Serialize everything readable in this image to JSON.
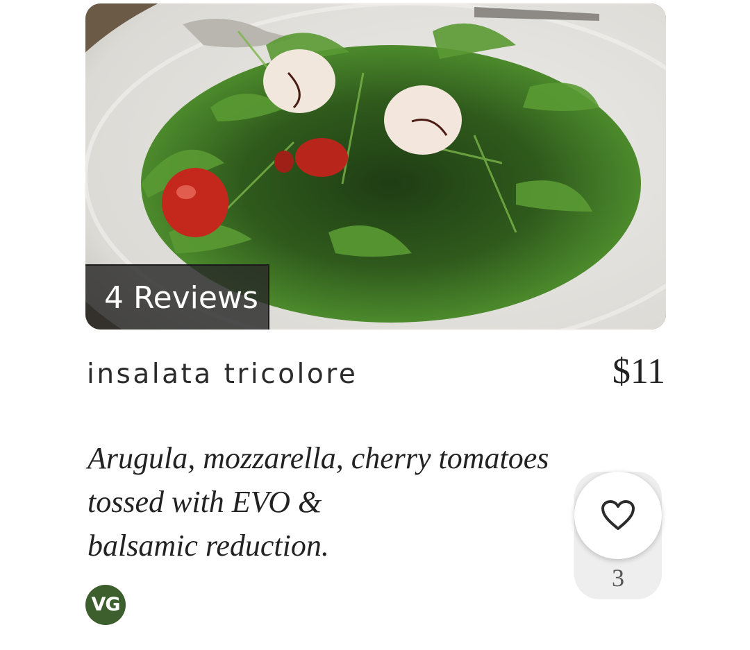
{
  "item": {
    "reviews_label": "4 Reviews",
    "name": "insalata tricolore",
    "price": "$11",
    "description_lines": [
      "Arugula, mozzarella, cherry tomatoes",
      "tossed with EVO &",
      "balsamic reduction."
    ],
    "diet_badge": "VG",
    "like_count": "3",
    "photo_icon": "salad-photo",
    "like_icon": "heart-outline-icon"
  },
  "colors": {
    "diet_badge_bg": "#3d5f2e",
    "like_pill_bg": "#eeeeee",
    "reviews_badge_bg": "#282828"
  }
}
